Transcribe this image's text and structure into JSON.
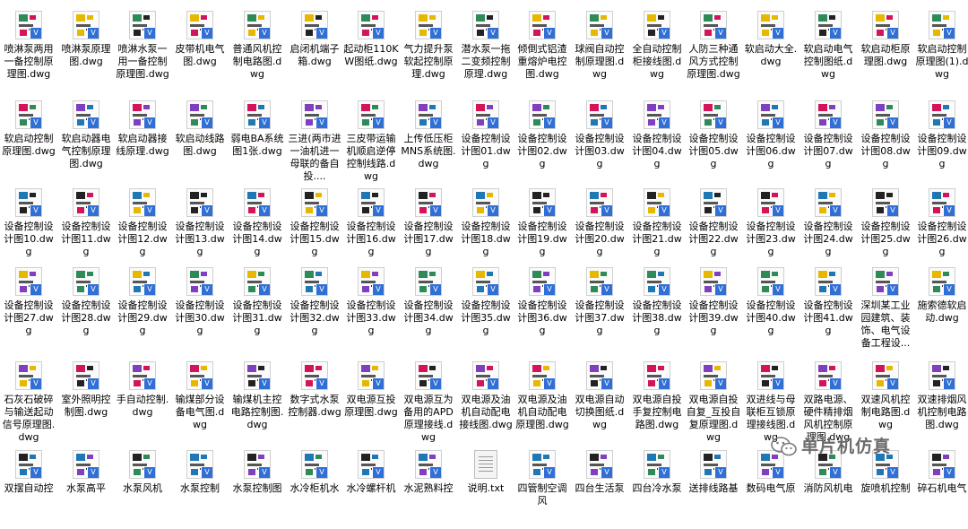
{
  "files": [
    [
      "喷淋泵两用一备控制原理图.dwg",
      "喷淋泵原理图.dwg",
      "喷淋水泵一用一备控制原理图.dwg",
      "皮带机电气图.dwg",
      "普通风机控制电路图.dwg",
      "启闭机端子箱.dwg",
      "起动柜110KW图纸.dwg",
      "气力提升泵软起控制原理.dwg",
      "潜水泵一拖二变频控制原理.dwg",
      "倾倒式铝渣重熔炉电控图.dwg",
      "球阀自动控制原理图.dwg",
      "全自动控制柜接线图.dwg",
      "人防三种通风方式控制原理图.dwg",
      "软启动大全.dwg",
      "软启动电气控制图纸.dwg",
      "软启动柜原理图.dwg",
      "软启动控制原理图(1).dwg"
    ],
    [
      "软启动控制原理图.dwg",
      "软启动器电气控制原理图.dwg",
      "软启动器接线原理.dwg",
      "软启动线路图.dwg",
      "弱电BA系统图1张.dwg",
      "三进(两市进一油机进一母联的备自投....",
      "三皮带运输机顺启逆停控制线路.dwg",
      "上传低压柜MNS系统图.dwg",
      "设备控制设计图01.dwg",
      "设备控制设计图02.dwg",
      "设备控制设计图03.dwg",
      "设备控制设计图04.dwg",
      "设备控制设计图05.dwg",
      "设备控制设计图06.dwg",
      "设备控制设计图07.dwg",
      "设备控制设计图08.dwg",
      "设备控制设计图09.dwg"
    ],
    [
      "设备控制设计图10.dwg",
      "设备控制设计图11.dwg",
      "设备控制设计图12.dwg",
      "设备控制设计图13.dwg",
      "设备控制设计图14.dwg",
      "设备控制设计图15.dwg",
      "设备控制设计图16.dwg",
      "设备控制设计图17.dwg",
      "设备控制设计图18.dwg",
      "设备控制设计图19.dwg",
      "设备控制设计图20.dwg",
      "设备控制设计图21.dwg",
      "设备控制设计图22.dwg",
      "设备控制设计图23.dwg",
      "设备控制设计图24.dwg",
      "设备控制设计图25.dwg",
      "设备控制设计图26.dwg"
    ],
    [
      "设备控制设计图27.dwg",
      "设备控制设计图28.dwg",
      "设备控制设计图29.dwg",
      "设备控制设计图30.dwg",
      "设备控制设计图31.dwg",
      "设备控制设计图32.dwg",
      "设备控制设计图33.dwg",
      "设备控制设计图34.dwg",
      "设备控制设计图35.dwg",
      "设备控制设计图36.dwg",
      "设备控制设计图37.dwg",
      "设备控制设计图38.dwg",
      "设备控制设计图39.dwg",
      "设备控制设计图40.dwg",
      "设备控制设计图41.dwg",
      "深圳某工业园建筑、装饰、电气设备工程设...",
      "施索德软启动.dwg"
    ],
    [
      "石灰石破碎与输送起动信号原理图.dwg",
      "室外照明控制图.dwg",
      "手自动控制.dwg",
      "输煤部分设备电气图.dwg",
      "输煤机主控电路控制图.dwg",
      "数字式水泵控制器.dwg",
      "双电源互投原理图.dwg",
      "双电源互为备用的APD原理接线.dwg",
      "双电源及油机自动配电接线图.dwg",
      "双电源及油机自动配电原理图.dwg",
      "双电源自动切换图纸.dwg",
      "双电源自投手复控制电路图.dwg",
      "双电源自投自复_互投自复原理图.dwg",
      "双进线与母联柜互锁原理接线图.dwg",
      "双路电源、硬件精排烟风机控制原理图.dwg",
      "双速风机控制电路图.dwg",
      "双速排烟风机控制电路图.dwg"
    ],
    [
      "双摆自动控",
      "水泵高平",
      "水泵风机",
      "水泵控制",
      "水泵控制图",
      "水冷柜机水",
      "水冷螺杆机",
      "水泥熟料控",
      "说明.txt",
      "四管制空调风",
      "四台生活泵",
      "四台冷水泵",
      "送排线路基",
      "数码电气原",
      "消防风机电",
      "旋喷机控制",
      "碎石机电气"
    ]
  ],
  "file_types": {
    "cad": "dwg",
    "text": "txt"
  },
  "badge_glyph": "Ⅴ",
  "watermark": {
    "text": "单片机仿真",
    "logo": "wechat-logo"
  },
  "colors": {
    "badge": "#2f6fd6",
    "label": "#000000",
    "watermark": "#6b6b6b",
    "thumb_accents": [
      "#2e8b57",
      "#d4145a",
      "#1f77b4",
      "#e6b800",
      "#7f3fbf",
      "#222222"
    ]
  }
}
